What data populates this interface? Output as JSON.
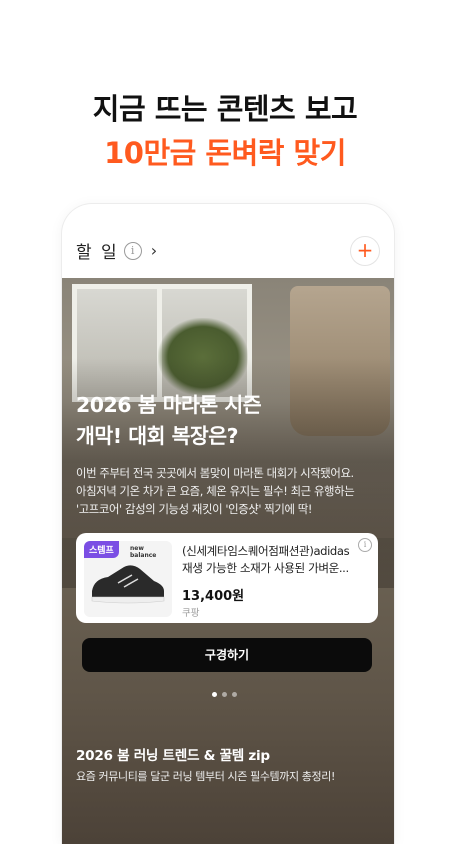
{
  "promo": {
    "line1": "지금 뜨는 콘텐츠 보고",
    "line2": "10만금 돈벼락 맞기"
  },
  "colors": {
    "accent": "#ff5a1f",
    "badge": "#7b4ee4",
    "button": "#0b0b0b"
  },
  "header": {
    "title": "할 일",
    "info_icon": "i",
    "chevron": "›",
    "plus": "+"
  },
  "card": {
    "title_line1": "2026 봄 마라톤 시즌",
    "title_line2": "개막! 대회 복장은?",
    "desc_line1": "이번 주부터 전국 곳곳에서 봄맞이 마라톤 대회가 시작됐어요.",
    "desc_line2": "아침저녁 기온 차가 큰 요즘, 체온 유지는 필수! 최근 유행하는",
    "desc_line3": "'고프코어' 감성의 기능성 재킷이 '인증샷' 찍기에 딱!"
  },
  "product": {
    "badge": "스템프",
    "brand": "new balance",
    "name": "(신세계타임스퀘어점패션관)adidas 재생 가능한 소재가 사용된 가벼운...",
    "price": "13,400원",
    "store": "쿠팡",
    "info_icon": "i"
  },
  "buy_button": "구경하기",
  "carousel": {
    "count": 3,
    "active": 0
  },
  "bottom": {
    "title": "2026 봄 러닝 트렌드 & 꿀템 zip",
    "desc": "요즘 커뮤니티를 달군 러닝 템부터 시즌 필수템까지 총정리!"
  }
}
